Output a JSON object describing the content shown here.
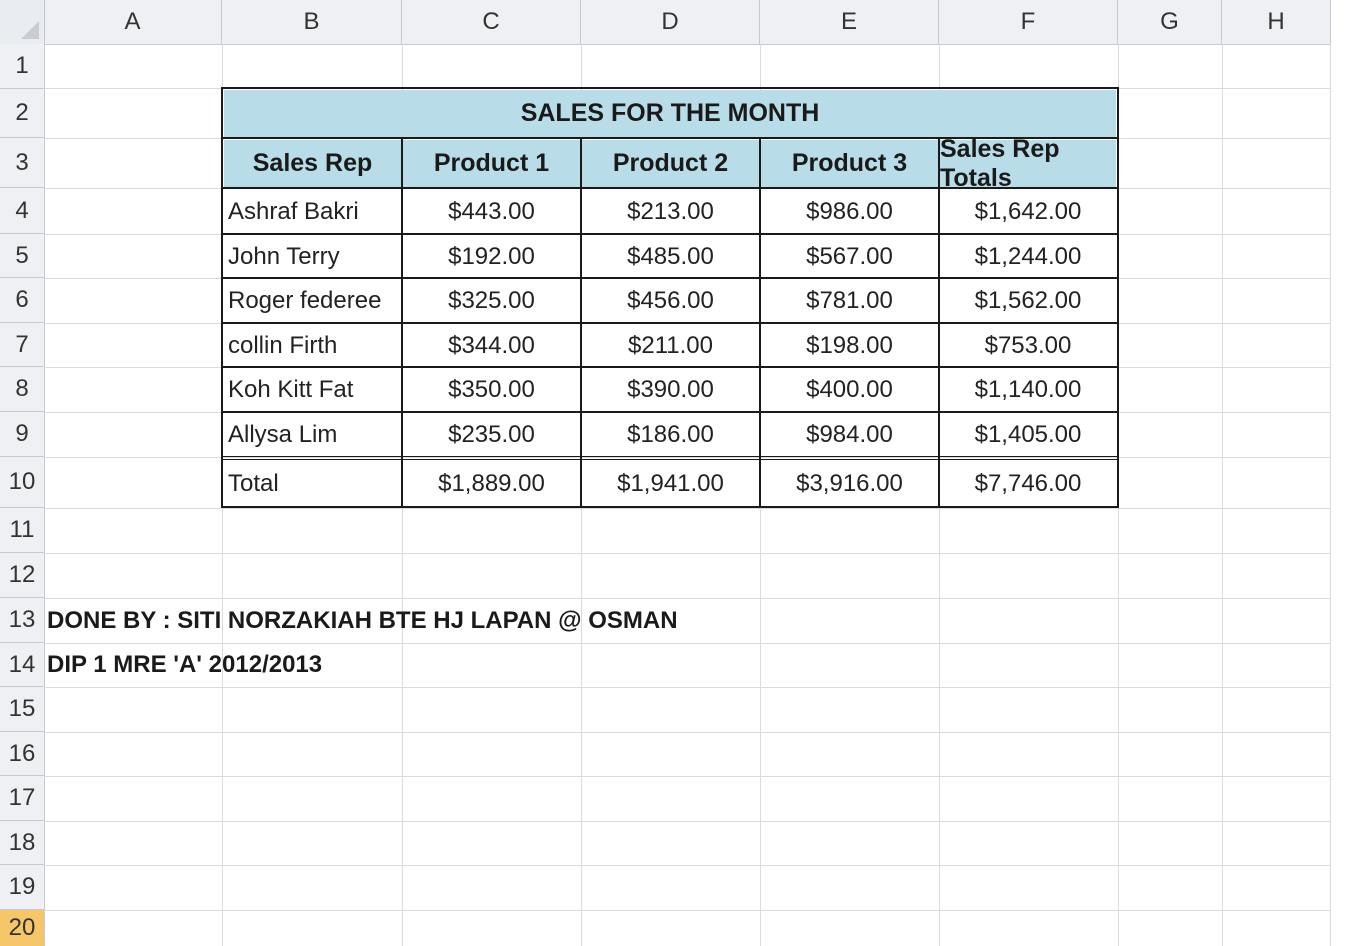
{
  "columns": [
    "A",
    "B",
    "C",
    "D",
    "E",
    "F",
    "G",
    "H"
  ],
  "rows": [
    "1",
    "2",
    "3",
    "4",
    "5",
    "6",
    "7",
    "8",
    "9",
    "10",
    "11",
    "12",
    "13",
    "14",
    "15",
    "16",
    "17",
    "18",
    "19",
    "20"
  ],
  "table": {
    "title": "SALES FOR THE MONTH",
    "headers": [
      "Sales Rep",
      "Product 1",
      "Product 2",
      "Product 3",
      "Sales Rep Totals"
    ],
    "data": [
      [
        "Ashraf Bakri",
        "$443.00",
        "$213.00",
        "$986.00",
        "$1,642.00"
      ],
      [
        "John Terry",
        "$192.00",
        "$485.00",
        "$567.00",
        "$1,244.00"
      ],
      [
        "Roger federee",
        "$325.00",
        "$456.00",
        "$781.00",
        "$1,562.00"
      ],
      [
        "collin Firth",
        "$344.00",
        "$211.00",
        "$198.00",
        "$753.00"
      ],
      [
        "Koh Kitt Fat",
        "$350.00",
        "$390.00",
        "$400.00",
        "$1,140.00"
      ],
      [
        "Allysa Lim",
        "$235.00",
        "$186.00",
        "$984.00",
        "$1,405.00"
      ]
    ],
    "total": [
      "Total",
      "$1,889.00",
      "$1,941.00",
      "$3,916.00",
      "$7,746.00"
    ]
  },
  "notes": {
    "done_by": "DONE BY : SITI NORZAKIAH BTE HJ LAPAN @ OSMAN",
    "class": "DIP 1 MRE 'A' 2012/2013"
  },
  "colors": {
    "header_fill": "#b8dde8",
    "active_row_header": "#f6c76a",
    "gridline": "#d9dcdf"
  }
}
